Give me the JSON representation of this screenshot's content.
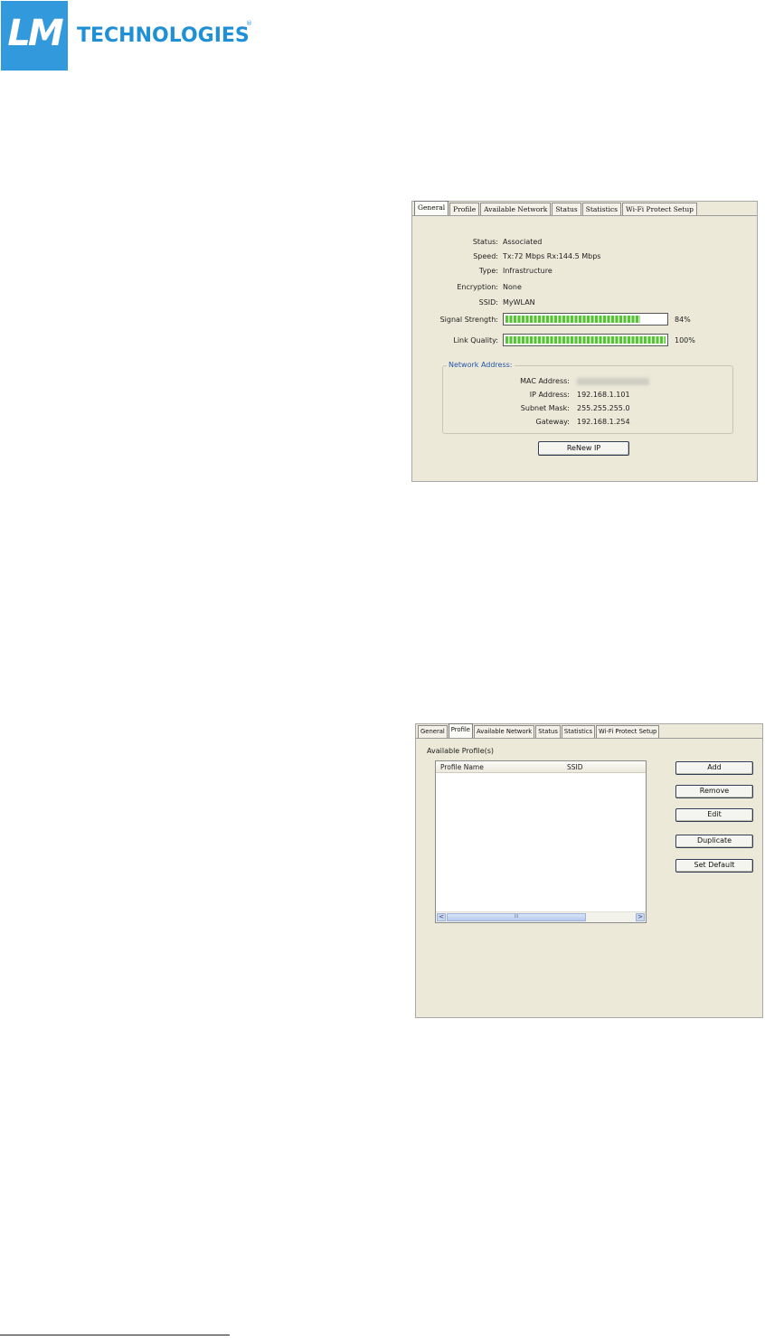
{
  "logo": {
    "mark": "LM",
    "word": "TECHNOLOGIES",
    "reg": "®",
    "color": "#1f8fd6"
  },
  "panel1": {
    "tabs": [
      "General",
      "Profile",
      "Available Network",
      "Status",
      "Statistics",
      "Wi-Fi Protect Setup"
    ],
    "active_tab": "General",
    "status": {
      "label": "Status:",
      "value": "Associated"
    },
    "speed": {
      "label": "Speed:",
      "value": "Tx:72 Mbps Rx:144.5 Mbps"
    },
    "type": {
      "label": "Type:",
      "value": "Infrastructure"
    },
    "encryption": {
      "label": "Encryption:",
      "value": "None"
    },
    "ssid": {
      "label": "SSID:",
      "value": "MyWLAN"
    },
    "signal_strength": {
      "label": "Signal Strength:",
      "percent": 84,
      "text": "84%"
    },
    "link_quality": {
      "label": "Link Quality:",
      "percent": 100,
      "text": "100%"
    },
    "network_address": {
      "title": "Network Address:",
      "mac": {
        "label": "MAC Address:",
        "value": ""
      },
      "ip": {
        "label": "IP Address:",
        "value": "192.168.1.101"
      },
      "subnet": {
        "label": "Subnet Mask:",
        "value": "255.255.255.0"
      },
      "gateway": {
        "label": "Gateway:",
        "value": "192.168.1.254"
      }
    },
    "renew_button": "ReNew IP"
  },
  "panel2": {
    "tabs": [
      "General",
      "Profile",
      "Available Network",
      "Status",
      "Statistics",
      "Wi-Fi Protect Setup"
    ],
    "active_tab": "Profile",
    "list_title": "Available Profile(s)",
    "columns": [
      "Profile Name",
      "SSID"
    ],
    "rows": [],
    "buttons": [
      "Add",
      "Remove",
      "Edit",
      "Duplicate",
      "Set Default"
    ],
    "scroll_left": "<",
    "scroll_right": ">",
    "scroll_grip": "III"
  }
}
